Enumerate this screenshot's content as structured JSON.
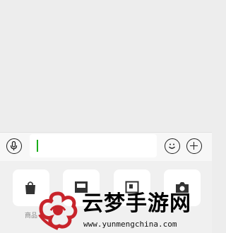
{
  "input_bar": {
    "text_value": "",
    "icons": [
      "microphone-icon",
      "emoji-icon",
      "plus-icon"
    ]
  },
  "more_panel": {
    "items": [
      {
        "label": "商品",
        "icon": "shopping-bag-icon"
      },
      {
        "label": "",
        "icon": "image-icon"
      },
      {
        "label": "",
        "icon": "frame-icon"
      },
      {
        "label": "",
        "icon": "camera-icon"
      }
    ]
  },
  "watermark": {
    "title": "云梦手游网",
    "url": "www.yunmengchina.com"
  },
  "colors": {
    "background": "#ededed",
    "cursor": "#1aad19",
    "logo_red": "#c8242b"
  }
}
